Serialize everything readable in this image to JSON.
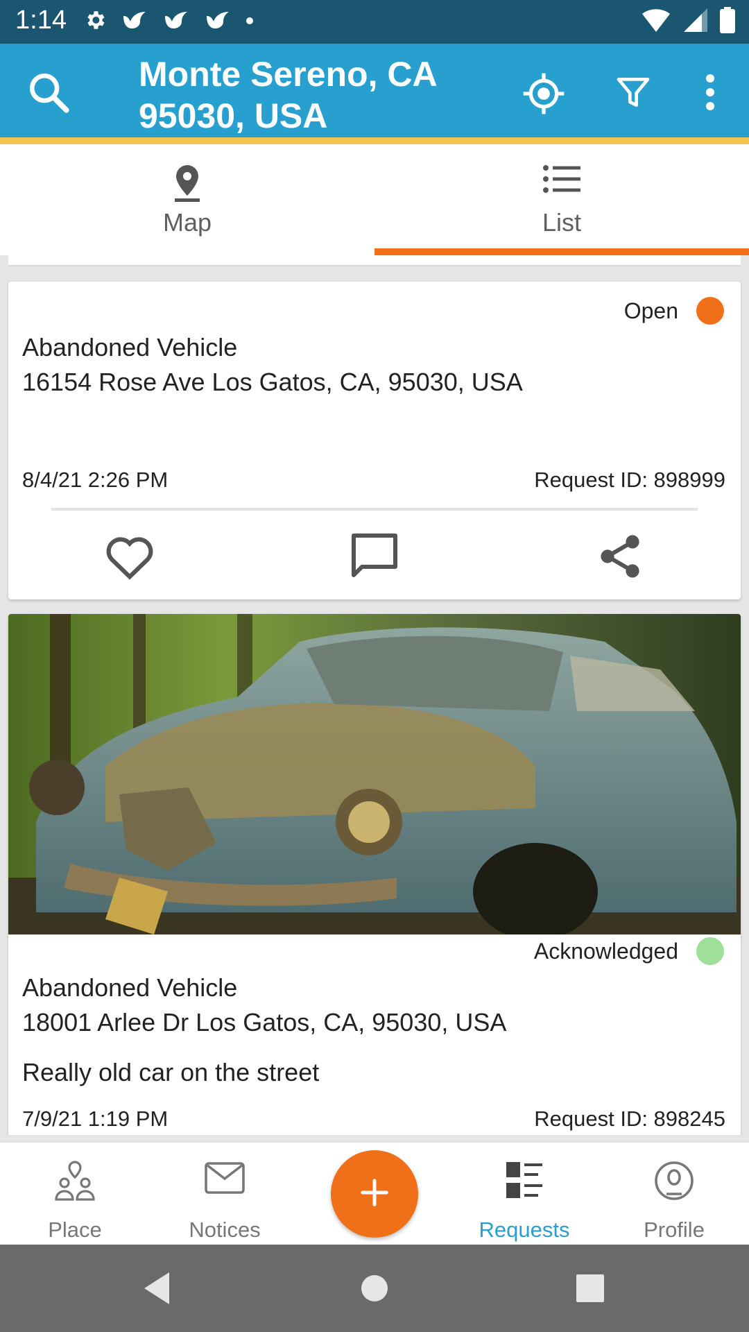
{
  "status_bar": {
    "time": "1:14"
  },
  "app_bar": {
    "title_line1": "Monte Sereno, CA",
    "title_line2": "95030, USA"
  },
  "tabs": [
    {
      "label": "Map",
      "icon": "map-pin-icon",
      "selected": false
    },
    {
      "label": "List",
      "icon": "list-icon",
      "selected": true
    }
  ],
  "requests": [
    {
      "status": "Open",
      "status_color": "#ef7019",
      "type": "Abandoned Vehicle",
      "address": "16154 Rose Ave Los Gatos, CA, 95030, USA",
      "description": "",
      "date": "8/4/21 2:26 PM",
      "request_id": "Request ID: 898999",
      "has_photo": false
    },
    {
      "status": "Acknowledged",
      "status_color": "#9ee09a",
      "type": "Abandoned Vehicle",
      "address": "18001 Arlee Dr Los Gatos, CA, 95030, USA",
      "description": "Really old car on the street",
      "date": "7/9/21 1:19 PM",
      "request_id": "Request ID: 898245",
      "has_photo": true
    }
  ],
  "card_actions": [
    {
      "icon": "heart-icon"
    },
    {
      "icon": "comment-icon"
    },
    {
      "icon": "share-icon"
    }
  ],
  "bottom_nav": [
    {
      "label": "Place",
      "icon": "place-people-icon",
      "active": false
    },
    {
      "label": "Notices",
      "icon": "envelope-icon",
      "active": false
    },
    {
      "label": "Requests",
      "icon": "requests-icon",
      "active": true
    },
    {
      "label": "Profile",
      "icon": "profile-icon",
      "active": false
    }
  ],
  "fab": {
    "icon": "plus-icon",
    "color": "#ef7019"
  },
  "colors": {
    "app_bar": "#27a0cf",
    "accent_line": "#f4c34f",
    "tab_indicator": "#ef7019",
    "status_bar": "#1a5670"
  }
}
